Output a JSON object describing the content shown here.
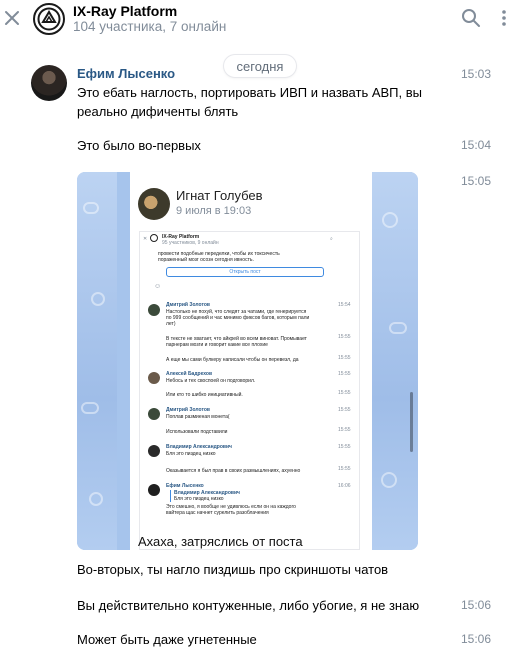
{
  "header": {
    "title": "IX-Ray Platform",
    "subtitle": "104 участника, 7 онлайн"
  },
  "date_separator": "сегодня",
  "messages": [
    {
      "author": "Ефим Лысенко",
      "time": "15:03",
      "text_line1": "Это ебать наглость, портировать ИВП и назвать АВП, вы",
      "text_line2": "реально дифиченты блять"
    },
    {
      "time": "15:04",
      "text": "Это было во-первых"
    },
    {
      "time": "15:05"
    },
    {
      "text": "Во-вторых, ты нагло пиздишь про скриншоты чатов"
    },
    {
      "time": "15:06",
      "text": "Вы действительно контуженные, либо убогие, я не знаю"
    },
    {
      "time": "15:06",
      "text": "Может быть даже угнетенные"
    }
  ],
  "attachment": {
    "post_author": "Игнат Голубев",
    "post_date": "9 июля в 19:03",
    "caption": "Ахаха, затряслись от поста",
    "inner": {
      "title": "IX-Ray Platform",
      "subtitle": "95 участников, 9 онлайн",
      "top_text": "провести подобные переделки, чтобы их токсичесть",
      "top_text2": "пораженный мозг осозн   сегодня   ивность.",
      "open_post": "Открыть пост",
      "rows": [
        {
          "author": "Дмитрий Золотов",
          "time": "15:54",
          "l1": "Настолько не похуй, что следят за чатами, где генерируется",
          "l2": "по 999 сообщений и час минимо фиксов багов, которым пали",
          "l3": "лет)"
        },
        {
          "time": "15:55",
          "l1": "В тексте не хватает, что айкрей во всем виноват. Промывает",
          "l2": "парнерам мозги и говорит какие все плохие"
        },
        {
          "time": "15:55",
          "l1": "А еще мы сами булкеру написали чтобы он перевезл, да"
        },
        {
          "author": "Алексей Бадрехов",
          "time": "15:55",
          "l1": "Небось и тех своспоей он подговорил."
        },
        {
          "time": "15:55",
          "l1": "Или кто то шибко инициативный."
        },
        {
          "author": "Дмитрий Золотов",
          "time": "15:55",
          "l1": "Поплав размиеная монета("
        },
        {
          "time": "15:55",
          "l1": "Использовали подставили"
        },
        {
          "author": "Владимир Александрович",
          "time": "15:55",
          "l1": "Бля это пиздец низко"
        },
        {
          "time": "15:55",
          "l1": "Оказывается я был прав в своих размышлениях, ахуенно"
        },
        {
          "author": "Ефим Лысенко",
          "time": "16:06",
          "l1": "Владимир Александрович",
          "l2": "Бля это пиздец низко",
          "l3": "Это смешно, я вообще не удивлюсь если он на каждого",
          "l4": "вайтера щас начнет сурелить разоблачения"
        }
      ]
    }
  }
}
